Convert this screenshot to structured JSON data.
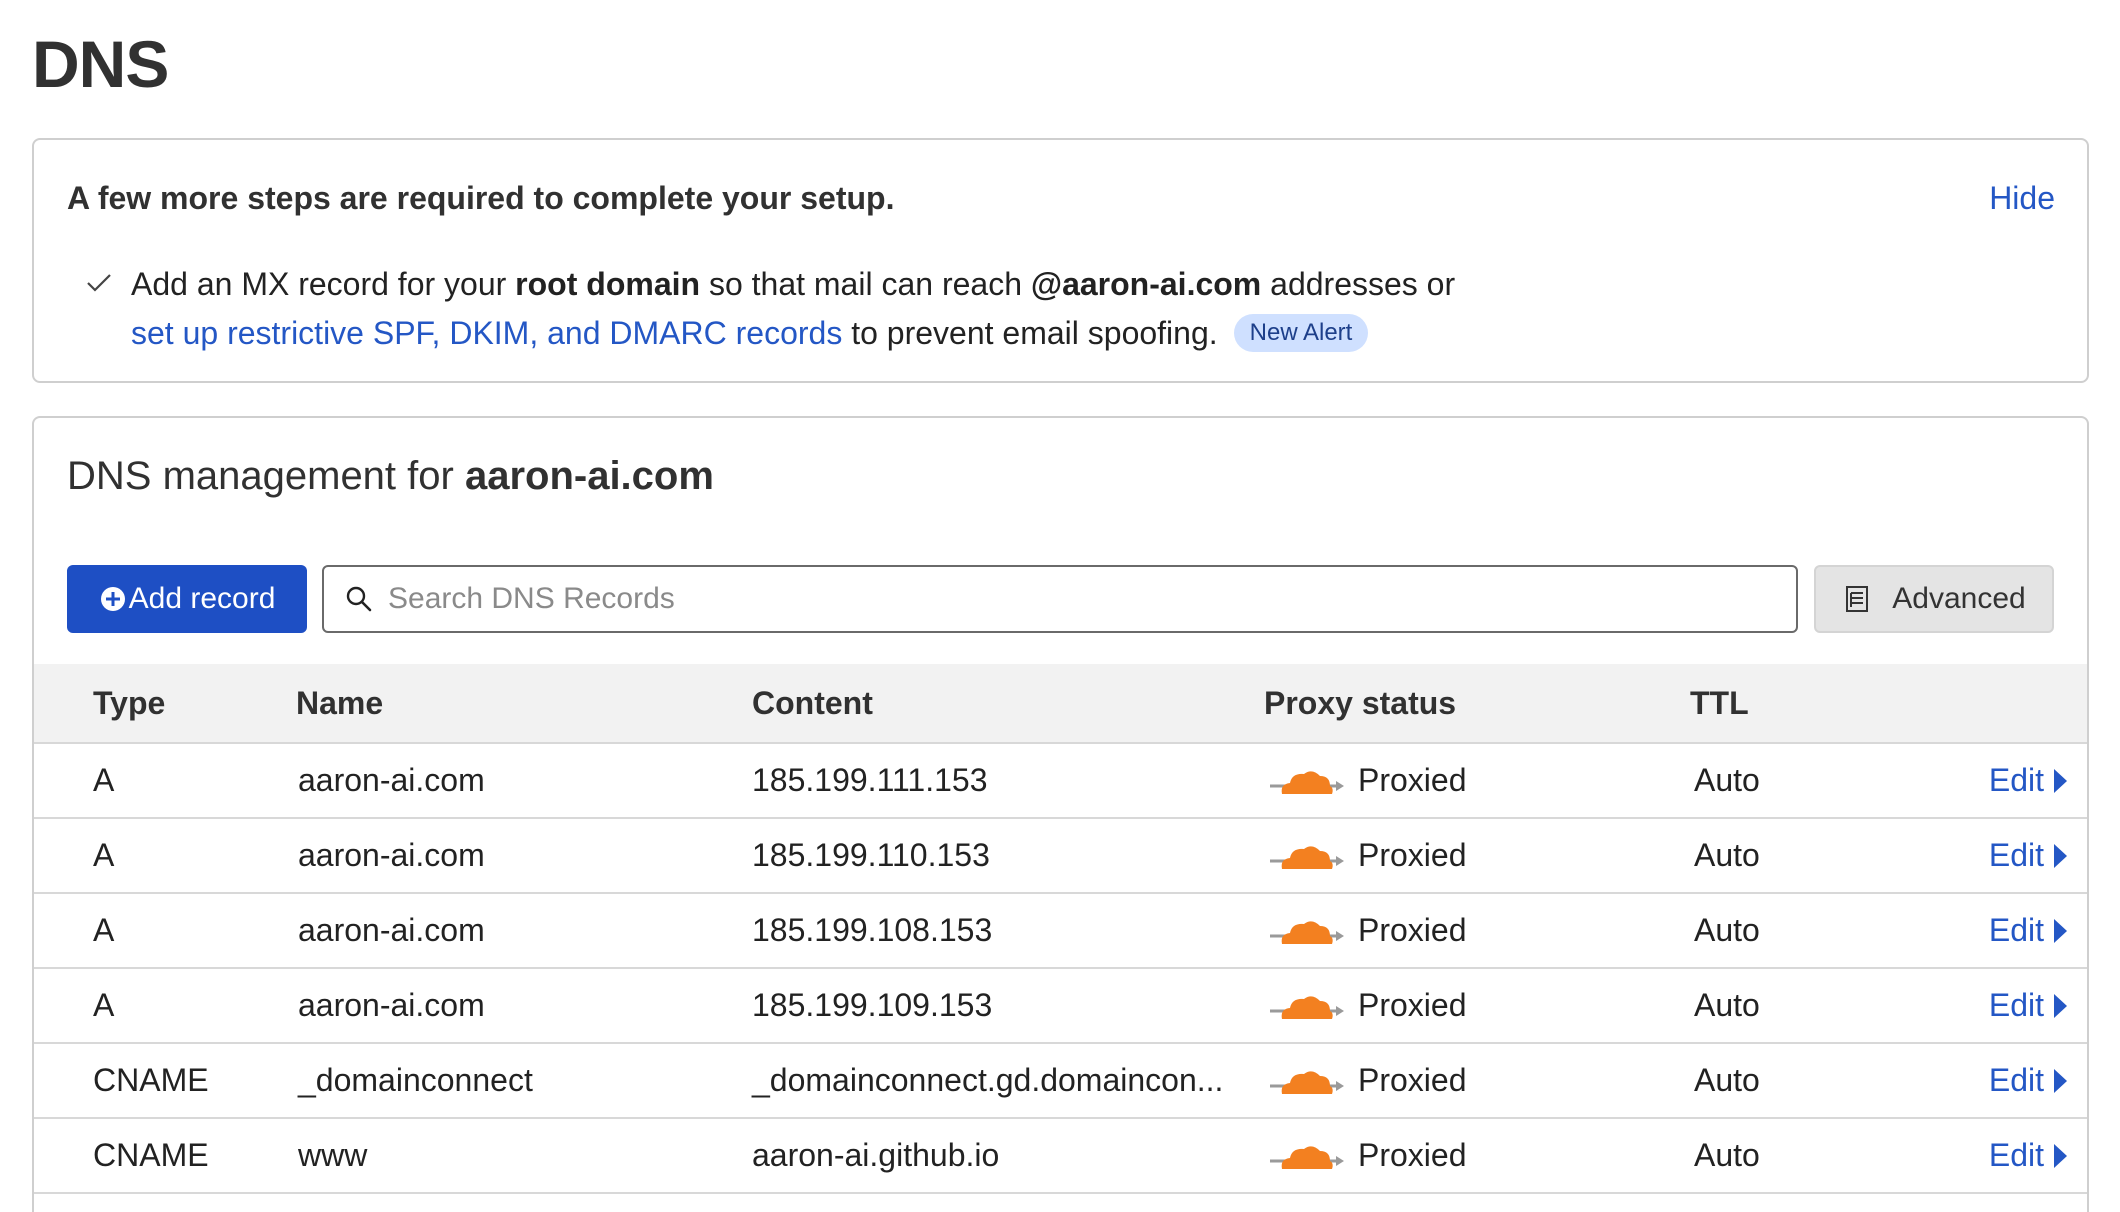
{
  "page": {
    "title": "DNS"
  },
  "setup": {
    "title": "A few more steps are required to complete your setup.",
    "hide_label": "Hide",
    "line1_prefix": "Add an MX record for your ",
    "line1_bold1": "root domain",
    "line1_mid": " so that mail can reach ",
    "line1_bold2": "@aaron-ai.com",
    "line1_suffix": " addresses or",
    "line2_link": "set up restrictive SPF, DKIM, and DMARC records",
    "line2_suffix": " to prevent email spoofing.",
    "badge": "New Alert"
  },
  "dns": {
    "heading_prefix": "DNS management for ",
    "domain": "aaron-ai.com",
    "add_record_label": "Add record",
    "search_placeholder": "Search DNS Records",
    "advanced_label": "Advanced",
    "columns": {
      "type": "Type",
      "name": "Name",
      "content": "Content",
      "proxy": "Proxy status",
      "ttl": "TTL"
    },
    "rows": [
      {
        "type": "A",
        "name": "aaron-ai.com",
        "content": "185.199.111.153",
        "proxy": "Proxied",
        "ttl": "Auto",
        "edit": "Edit"
      },
      {
        "type": "A",
        "name": "aaron-ai.com",
        "content": "185.199.110.153",
        "proxy": "Proxied",
        "ttl": "Auto",
        "edit": "Edit"
      },
      {
        "type": "A",
        "name": "aaron-ai.com",
        "content": "185.199.108.153",
        "proxy": "Proxied",
        "ttl": "Auto",
        "edit": "Edit"
      },
      {
        "type": "A",
        "name": "aaron-ai.com",
        "content": "185.199.109.153",
        "proxy": "Proxied",
        "ttl": "Auto",
        "edit": "Edit"
      },
      {
        "type": "CNAME",
        "name": "_domainconnect",
        "content": "_domainconnect.gd.domaincon...",
        "proxy": "Proxied",
        "ttl": "Auto",
        "edit": "Edit"
      },
      {
        "type": "CNAME",
        "name": "www",
        "content": "aaron-ai.github.io",
        "proxy": "Proxied",
        "ttl": "Auto",
        "edit": "Edit"
      }
    ]
  },
  "colors": {
    "primary": "#1e4fc4",
    "link": "#2457c5",
    "proxy_cloud": "#f38020",
    "badge_bg": "#cfe0ff"
  },
  "icons": {
    "check": "check-icon",
    "plus": "plus-circle-icon",
    "search": "search-icon",
    "advanced": "document-icon",
    "proxy": "proxied-cloud-icon",
    "edit": "caret-right-icon"
  }
}
